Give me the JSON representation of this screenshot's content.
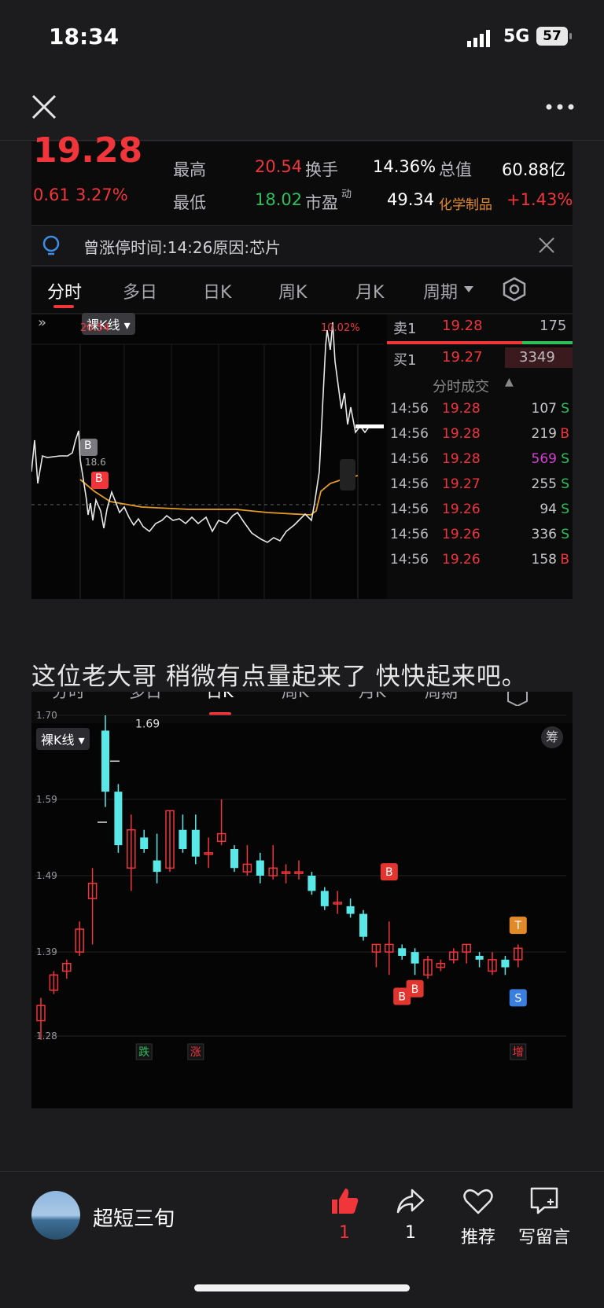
{
  "status": {
    "time": "18:34",
    "network": "5G",
    "battery": "57"
  },
  "nav": {
    "close_icon": "close-icon",
    "more_icon": "more-icon"
  },
  "quote": {
    "price": "19.28",
    "change": "0.61",
    "change_pct": "3.27%",
    "high_label": "最高",
    "high": "20.54",
    "low_label": "最低",
    "low": "18.02",
    "turnover_label": "换手",
    "turnover": "14.36%",
    "pe_label": "市盈",
    "pe_sup": "动",
    "pe": "49.34",
    "mcap_label": "总值",
    "mcap": "60.88亿",
    "sector_label": "化学制品",
    "sector_pct": "+1.43%"
  },
  "notice": {
    "text": "曾涨停时间:14:26原因:芯片"
  },
  "tabs": [
    "分时",
    "多日",
    "日K",
    "周K",
    "月K",
    "周期"
  ],
  "intraday": {
    "kline_toggle": "裸K线",
    "high_label": "20.54",
    "high_pct": "10.02%",
    "mid_label": "18.6",
    "b_markers": [
      "B",
      "B"
    ],
    "sell1": {
      "label": "卖1",
      "price": "19.28",
      "vol": "175"
    },
    "buy1": {
      "label": "买1",
      "price": "19.27",
      "vol": "3349"
    },
    "trades_header": "分时成交",
    "trades": [
      {
        "time": "14:56",
        "price": "19.28",
        "vol": "107",
        "side": "S"
      },
      {
        "time": "14:56",
        "price": "19.28",
        "vol": "219",
        "side": "B"
      },
      {
        "time": "14:56",
        "price": "19.28",
        "vol": "569",
        "side": "S"
      },
      {
        "time": "14:56",
        "price": "19.27",
        "vol": "255",
        "side": "S"
      },
      {
        "time": "14:56",
        "price": "19.26",
        "vol": "94",
        "side": "S"
      },
      {
        "time": "14:56",
        "price": "19.26",
        "vol": "336",
        "side": "S"
      },
      {
        "time": "14:56",
        "price": "19.26",
        "vol": "158",
        "side": "B"
      }
    ]
  },
  "post": {
    "text": "这位老大哥 稍微有点量起来了 快快起来吧。"
  },
  "kchart": {
    "kline_toggle": "裸K线",
    "chip_btn": "筹",
    "y_labels": [
      "1.70",
      "1.59",
      "1.49",
      "1.39",
      "1.28"
    ],
    "peak_label": "1.69",
    "bottom_tags": [
      "跌",
      "涨",
      "增"
    ],
    "markers": [
      "B",
      "B",
      "B",
      "T",
      "S"
    ],
    "candles": [
      [
        1.3,
        1.32,
        1.33,
        1.275
      ],
      [
        1.34,
        1.36,
        1.365,
        1.335
      ],
      [
        1.365,
        1.375,
        1.38,
        1.355
      ],
      [
        1.39,
        1.42,
        1.43,
        1.385
      ],
      [
        1.46,
        1.48,
        1.5,
        1.4
      ],
      [
        1.68,
        1.6,
        1.7,
        1.58
      ],
      [
        1.6,
        1.53,
        1.61,
        1.52
      ],
      [
        1.5,
        1.55,
        1.57,
        1.47
      ],
      [
        1.54,
        1.525,
        1.55,
        1.52
      ],
      [
        1.51,
        1.495,
        1.545,
        1.48
      ],
      [
        1.5,
        1.575,
        1.575,
        1.495
      ],
      [
        1.55,
        1.525,
        1.57,
        1.52
      ],
      [
        1.55,
        1.515,
        1.57,
        1.505
      ],
      [
        1.52,
        1.52,
        1.54,
        1.5
      ],
      [
        1.535,
        1.545,
        1.59,
        1.53
      ],
      [
        1.525,
        1.5,
        1.53,
        1.495
      ],
      [
        1.495,
        1.505,
        1.53,
        1.49
      ],
      [
        1.51,
        1.49,
        1.52,
        1.48
      ],
      [
        1.49,
        1.5,
        1.53,
        1.485
      ],
      [
        1.495,
        1.495,
        1.505,
        1.48
      ],
      [
        1.495,
        1.495,
        1.51,
        1.485
      ],
      [
        1.49,
        1.47,
        1.495,
        1.465
      ],
      [
        1.47,
        1.45,
        1.475,
        1.445
      ],
      [
        1.455,
        1.455,
        1.47,
        1.44
      ],
      [
        1.45,
        1.44,
        1.46,
        1.435
      ],
      [
        1.44,
        1.41,
        1.445,
        1.405
      ],
      [
        1.39,
        1.4,
        1.4,
        1.37
      ],
      [
        1.39,
        1.4,
        1.43,
        1.36
      ],
      [
        1.395,
        1.385,
        1.4,
        1.38
      ],
      [
        1.39,
        1.375,
        1.395,
        1.36
      ],
      [
        1.36,
        1.38,
        1.385,
        1.355
      ],
      [
        1.37,
        1.375,
        1.38,
        1.365
      ],
      [
        1.38,
        1.39,
        1.395,
        1.375
      ],
      [
        1.39,
        1.4,
        1.4,
        1.375
      ],
      [
        1.385,
        1.38,
        1.39,
        1.37
      ],
      [
        1.365,
        1.38,
        1.39,
        1.36
      ],
      [
        1.38,
        1.37,
        1.385,
        1.36
      ],
      [
        1.38,
        1.395,
        1.4,
        1.37
      ]
    ]
  },
  "actions": {
    "like_count": "1",
    "share_count": "1",
    "recommend_label": "推荐",
    "comment_label": "写留言"
  },
  "user": {
    "name": "超短三旬"
  },
  "colors": {
    "up": "#f0353b",
    "down": "#58e8e8",
    "avg": "#e69b25",
    "bg": "#1c1c1e"
  }
}
